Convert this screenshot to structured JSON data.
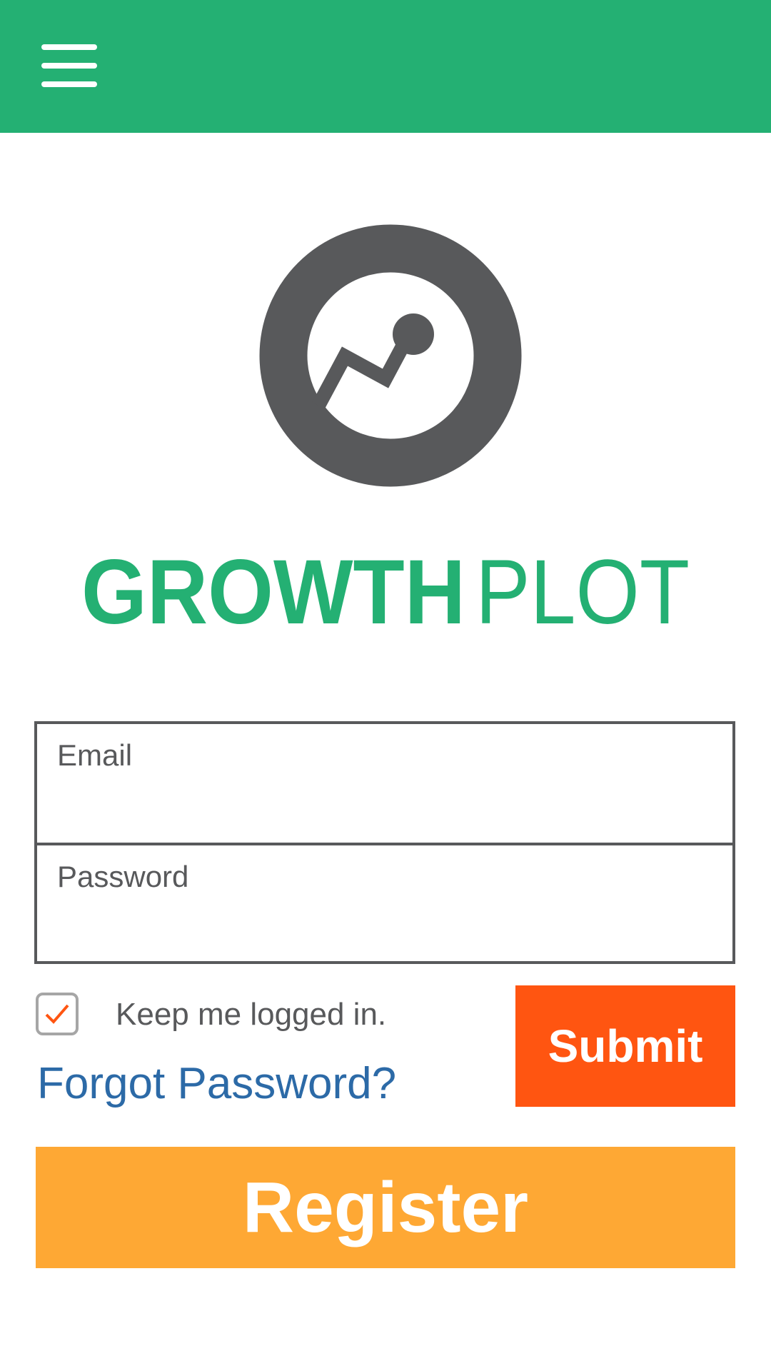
{
  "app": {
    "brand_bold": "GROWTH",
    "brand_light": "PLOT",
    "accent_color": "#24b073",
    "logo_color": "#58595b"
  },
  "header": {
    "menu_icon": "hamburger-menu-icon"
  },
  "form": {
    "email_label": "Email",
    "email_value": "",
    "password_label": "Password",
    "password_value": "",
    "keep_logged_in_label": "Keep me logged in.",
    "keep_logged_in_checked": true,
    "forgot_password_label": "Forgot Password?",
    "submit_label": "Submit",
    "submit_color": "#ff5511"
  },
  "register": {
    "label": "Register",
    "color": "#fea834"
  }
}
